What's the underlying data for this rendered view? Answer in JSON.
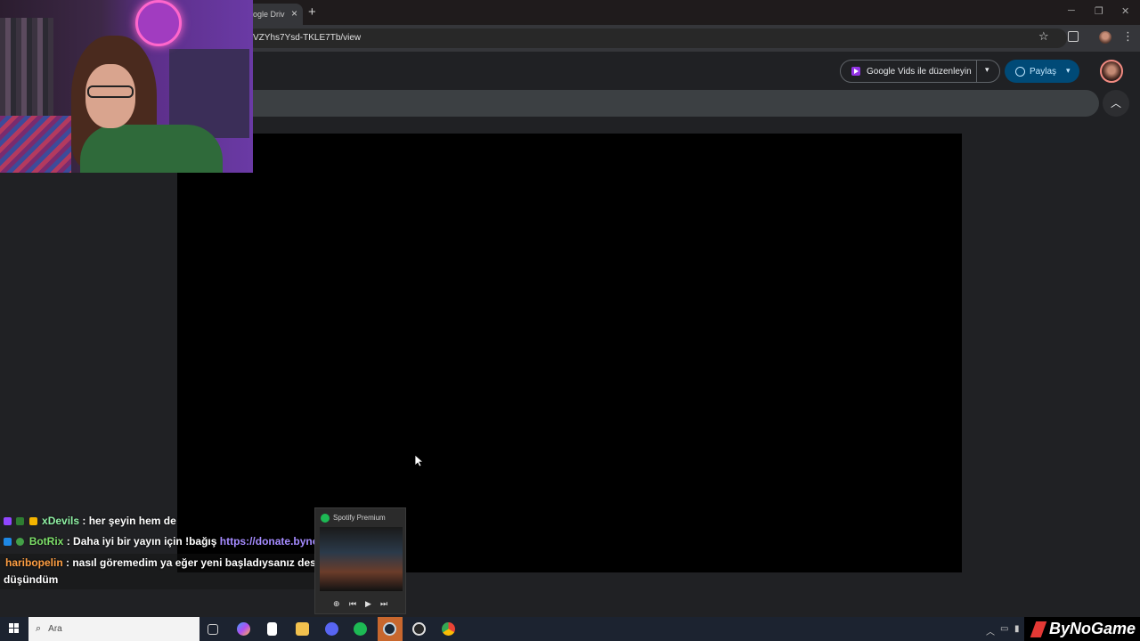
{
  "browser": {
    "tab_title": "ogle Driv",
    "tab_close": "×",
    "new_tab": "+",
    "url": "VZYhs7Ysd-TKLE7Tb/view",
    "window_controls": {
      "minimize": "─",
      "restore": "❐",
      "close": "✕"
    }
  },
  "viewer": {
    "vids_button_label": "Google Vids ile düzenleyin",
    "vids_dropdown": "▾",
    "share_label": "Paylaş",
    "share_dropdown": "▾",
    "collapse_icon": "︿"
  },
  "chat": {
    "messages": [
      {
        "user": "xDevils",
        "text": " : her şeyin hem de"
      },
      {
        "user": "BotRix",
        "text": " : Daha iyi bir yayın için !bağış ",
        "link": "https://donate.bynogame.com/biy"
      },
      {
        "user": "haribopelin",
        "text": " : nasıl göremedim ya eğer yeni başladıysanız desteklerimdim di",
        "continuation": "düşündüm"
      }
    ]
  },
  "spotify": {
    "title": "Spotify Premium",
    "controls": {
      "add": "⊕",
      "prev": "⏮",
      "play": "▶",
      "next": "⏭"
    }
  },
  "taskbar": {
    "search_placeholder": "Ara",
    "search_icon": "⌕"
  },
  "tray": {
    "caret": "︿"
  },
  "watermark": {
    "text": "ByNoGame"
  },
  "colors": {
    "share_bg": "#004a77",
    "spotify_green": "#1db954",
    "taskbar_highlight": "#c8672e"
  }
}
